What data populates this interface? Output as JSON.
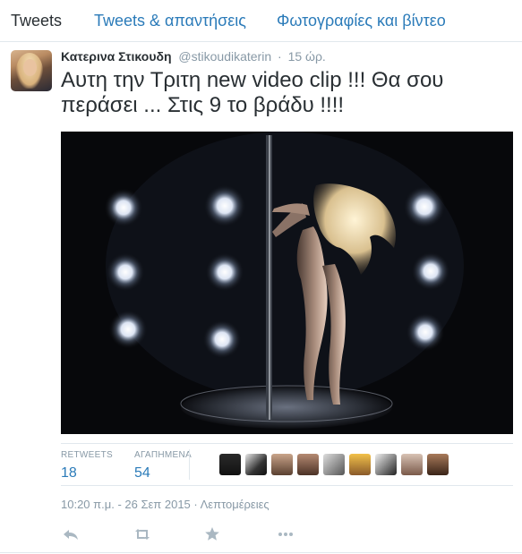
{
  "tabs": [
    {
      "label": "Tweets",
      "active": true
    },
    {
      "label": "Tweets & απαντήσεις",
      "active": false
    },
    {
      "label": "Φωτογραφίες και βίντεο",
      "active": false
    }
  ],
  "tweet": {
    "author_name": "Κατερινα Στικουδη",
    "handle": "@stikoudikaterin",
    "separator": "·",
    "time_ago": "15 ώρ.",
    "text": "Αυτη την Τριτη new video clip !!! Θα σου περάσει ... Στις 9 το βράδυ !!!!",
    "stats": {
      "retweets_label": "RETWEETS",
      "retweets": "18",
      "favorites_label": "ΑΓΑΠΗΜΕΝΑ",
      "favorites": "54"
    },
    "favorited_by_count_shown": 9,
    "timestamp": "10:20 π.μ. - 26 Σεπ 2015 · Λεπτομέρειες",
    "actions": [
      {
        "name": "reply-icon"
      },
      {
        "name": "retweet-icon"
      },
      {
        "name": "favorite-icon"
      },
      {
        "name": "more-icon"
      }
    ]
  },
  "colors": {
    "link": "#2b7bb9",
    "muted": "#8899a6",
    "text": "#292f33",
    "action_icon": "#aab8c2"
  }
}
